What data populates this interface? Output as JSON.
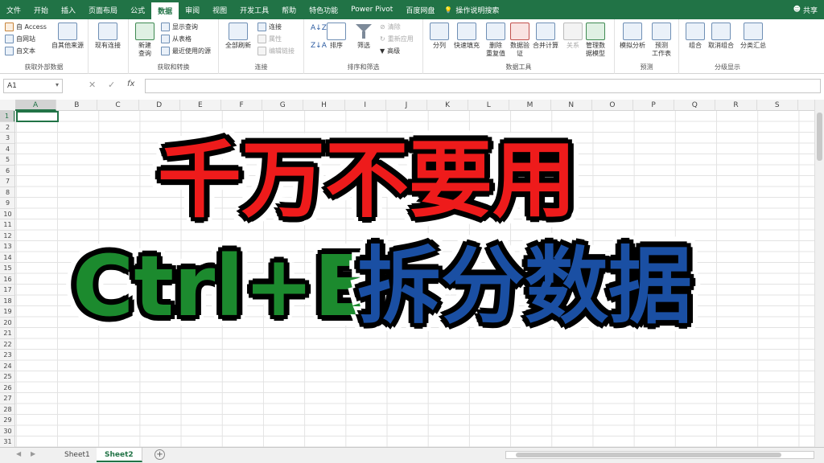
{
  "tabs": [
    "文件",
    "开始",
    "插入",
    "页面布局",
    "公式",
    "数据",
    "审阅",
    "视图",
    "开发工具",
    "帮助",
    "特色功能",
    "Power Pivot",
    "百度网盘"
  ],
  "active_tab": "数据",
  "tell_me": "操作说明搜索",
  "share": "共享",
  "ribbon": {
    "get_external": {
      "label": "获取外部数据",
      "access": "自 Access",
      "web": "自网站",
      "text": "自文本",
      "other": "自其他来源",
      "existing": "现有连接"
    },
    "transform": {
      "label": "获取和转换",
      "new_query": "新建\n查询",
      "show_queries": "显示查询",
      "from_table": "从表格",
      "recent_sources": "最近使用的源"
    },
    "connections": {
      "label": "连接",
      "refresh_all": "全部刷新",
      "connections": "连接",
      "properties": "属性",
      "edit_links": "编辑链接"
    },
    "sort_filter": {
      "label": "排序和筛选",
      "sort": "排序",
      "filter": "筛选",
      "clear": "清除",
      "reapply": "重新应用",
      "advanced": "高级"
    },
    "data_tools": {
      "label": "数据工具",
      "text_to_columns": "分列",
      "flash_fill": "快速填充",
      "remove_dup": "删除\n重复值",
      "validation": "数据验\n证",
      "consolidate": "合并计算",
      "relationships": "关系",
      "data_model": "管理数\n据模型"
    },
    "forecast": {
      "label": "预测",
      "whatif": "模拟分析",
      "forecast_sheet": "预测\n工作表"
    },
    "outline": {
      "label": "分级显示",
      "group": "组合",
      "ungroup": "取消组合",
      "subtotal": "分类汇总"
    }
  },
  "name_box": "A1",
  "formula_icons": {
    "cancel": "✕",
    "enter": "✓",
    "fx": "fx"
  },
  "columns": [
    "A",
    "B",
    "C",
    "D",
    "E",
    "F",
    "G",
    "H",
    "I",
    "J",
    "K",
    "L",
    "M",
    "N",
    "O",
    "P",
    "Q",
    "R",
    "S"
  ],
  "rows": [
    "1",
    "2",
    "3",
    "4",
    "5",
    "6",
    "7",
    "8",
    "9",
    "10",
    "11",
    "12",
    "13",
    "14",
    "15",
    "16",
    "17",
    "18",
    "19",
    "20",
    "21",
    "22",
    "23",
    "24",
    "25",
    "26",
    "27",
    "28",
    "29",
    "30",
    "31"
  ],
  "selected_cell": {
    "col": "A",
    "row": "1"
  },
  "sheets": [
    "Sheet1",
    "Sheet2"
  ],
  "active_sheet": "Sheet2",
  "overlay": {
    "line1": "千万不要用",
    "line2a": "Ctrl+E",
    "line2b": "拆分数据"
  },
  "colors": {
    "accent": "#217346",
    "title_red": "#ee1b1b",
    "title_green": "#1c8a2e",
    "title_blue": "#1a4fa3"
  }
}
